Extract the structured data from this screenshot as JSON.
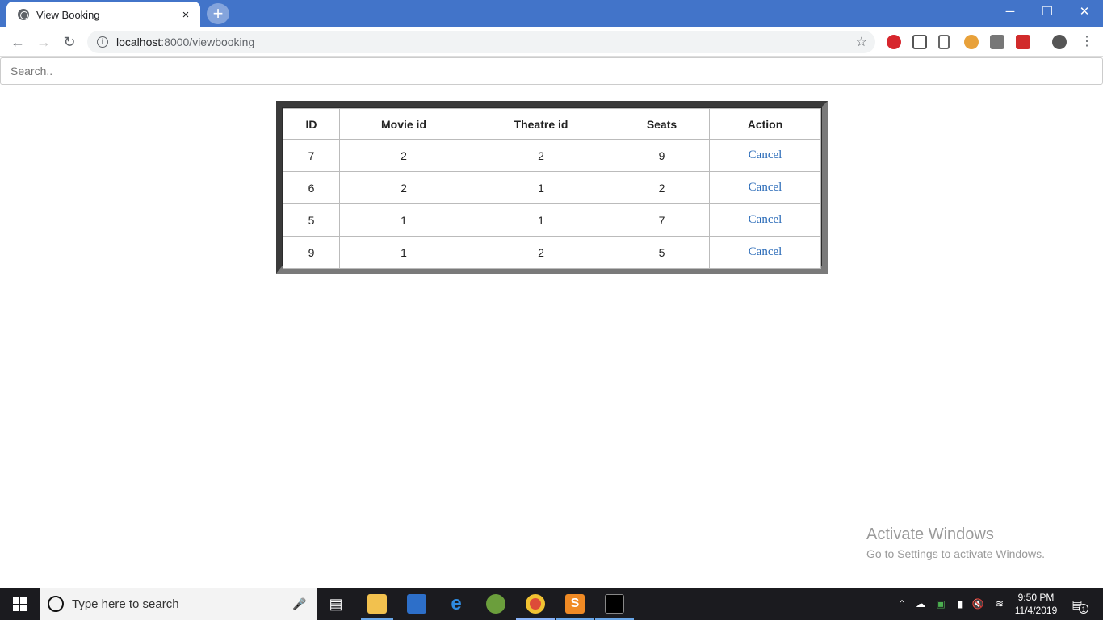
{
  "browser": {
    "tab_title": "View Booking",
    "tab_close": "×",
    "new_tab": "+",
    "url_host": "localhost",
    "url_path": ":8000/viewbooking",
    "window_controls": {
      "minimize": "─",
      "restore": "❐",
      "close": "✕"
    }
  },
  "page": {
    "search_placeholder": "Search..",
    "table": {
      "headers": [
        "ID",
        "Movie id",
        "Theatre id",
        "Seats",
        "Action"
      ],
      "rows": [
        [
          "7",
          "2",
          "2",
          "9",
          "Cancel"
        ],
        [
          "6",
          "2",
          "1",
          "2",
          "Cancel"
        ],
        [
          "5",
          "1",
          "1",
          "7",
          "Cancel"
        ],
        [
          "9",
          "1",
          "2",
          "5",
          "Cancel"
        ]
      ]
    }
  },
  "watermark": {
    "line1": "Activate Windows",
    "line2": "Go to Settings to activate Windows."
  },
  "taskbar": {
    "search_placeholder": "Type here to search",
    "time": "9:50 PM",
    "date": "11/4/2019",
    "notification_count": "1"
  },
  "colors": {
    "titlebar": "#4274c9",
    "link": "#2a6bb8",
    "taskbar": "#1b1b1f"
  }
}
